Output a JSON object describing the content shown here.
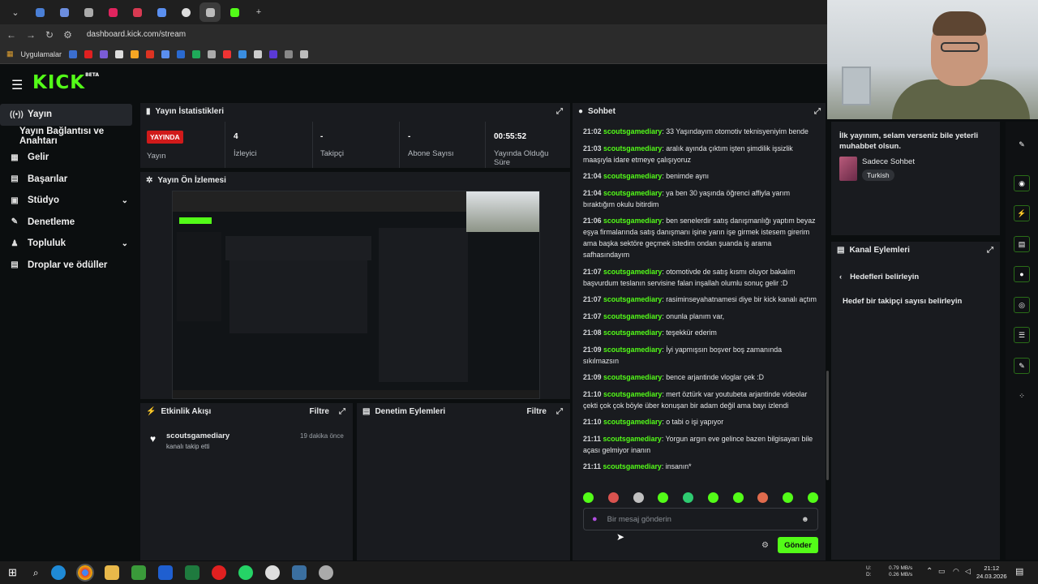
{
  "browser": {
    "url": "dashboard.kick.com/stream",
    "bookmarks_label": "Uygulamalar",
    "tab_colors": [
      "#4a7fd6",
      "#6c8ee0",
      "#aaaaaa",
      "#e0245e",
      "#d83a52",
      "#5a8ff0",
      "#dddddd",
      "#bbbbbb",
      "#53fc18"
    ]
  },
  "kick": {
    "logo": "KICK",
    "logo_sup": "BETA",
    "accent": "#53fc18"
  },
  "sidebar": {
    "items": [
      {
        "label": "Yayın",
        "icon": "broadcast-icon"
      },
      {
        "label": "Yayın Bağlantısı ve Anahtarı",
        "icon": ""
      },
      {
        "label": "Gelir",
        "icon": "revenue-icon"
      },
      {
        "label": "Başarılar",
        "icon": "achievements-icon"
      },
      {
        "label": "Stüdyo",
        "icon": "studio-icon"
      },
      {
        "label": "Denetleme",
        "icon": "moderation-icon"
      },
      {
        "label": "Topluluk",
        "icon": "community-icon"
      },
      {
        "label": "Droplar ve ödüller",
        "icon": "drops-icon"
      }
    ]
  },
  "stats": {
    "title": "Yayın İstatistikleri",
    "live_badge": "YAYINDA",
    "live_label": "Yayın",
    "viewers_value": "4",
    "viewers_label": "İzleyici",
    "followers_value": "-",
    "followers_label": "Takipçi",
    "subs_value": "-",
    "subs_label": "Abone Sayısı",
    "uptime_value": "00:55:52",
    "uptime_label": "Yayında Olduğu Süre"
  },
  "preview": {
    "title": "Yayın Ön İzlemesi"
  },
  "activity": {
    "title": "Etkinlik Akışı",
    "filter": "Filtre",
    "event_user": "scoutsgamediary",
    "event_text": "kanalı takip etti",
    "event_time": "19 dakika önce"
  },
  "moderation": {
    "title": "Denetim Eylemleri",
    "filter": "Filtre"
  },
  "chat": {
    "title": "Sohbet",
    "messages": [
      {
        "time": "21:02",
        "user": "scoutsgamediary",
        "text": "33 Yaşındayım otomotiv teknisyeniyim bende"
      },
      {
        "time": "21:03",
        "user": "scoutsgamediary",
        "text": "aralık ayında çıktım işten şimdilik işsizlik maaşıyla idare etmeye çalışıyoruz"
      },
      {
        "time": "21:04",
        "user": "scoutsgamediary",
        "text": "benimde aynı"
      },
      {
        "time": "21:04",
        "user": "scoutsgamediary",
        "text": "ya ben 30 yaşında öğrenci affiyla yarım bıraktığım okulu bitirdim"
      },
      {
        "time": "21:06",
        "user": "scoutsgamediary",
        "text": "ben senelerdir satış danışmanlığı yaptım beyaz eşya firmalarında satış danışmanı işine yarın işe girmek istesem girerim ama başka sektöre geçmek istedim ondan şuanda iş arama safhasındayım"
      },
      {
        "time": "21:07",
        "user": "scoutsgamediary",
        "text": "otomotivde de satış kısmı oluyor bakalım başvurdum teslanın servisine falan inşallah olumlu sonuç gelir :D"
      },
      {
        "time": "21:07",
        "user": "scoutsgamediary",
        "text": "rasiminseyahatnamesi diye bir kick kanalı açtım"
      },
      {
        "time": "21:07",
        "user": "scoutsgamediary",
        "text": "onunla planım var,"
      },
      {
        "time": "21:08",
        "user": "scoutsgamediary",
        "text": "teşekkür ederim"
      },
      {
        "time": "21:09",
        "user": "scoutsgamediary",
        "text": "İyi yapmışsın boşver boş zamanında sıkılmazsın"
      },
      {
        "time": "21:09",
        "user": "scoutsgamediary",
        "text": "bence arjantinde vloglar çek :D"
      },
      {
        "time": "21:10",
        "user": "scoutsgamediary",
        "text": "mert öztürk var youtubeta arjantinde videolar çekti çok çok böyle über konuşan bir adam değil ama bayı izlendi"
      },
      {
        "time": "21:10",
        "user": "scoutsgamediary",
        "text": "o tabi o işi yapıyor"
      },
      {
        "time": "21:11",
        "user": "scoutsgamediary",
        "text": "Yorgun argın eve gelince bazen bilgisayarı bile açası gelmiyor inanın"
      },
      {
        "time": "21:11",
        "user": "scoutsgamediary",
        "text": "insanın*"
      }
    ],
    "emote_colors": [
      "#53fc18",
      "#d9534f",
      "#c0c0c0",
      "#53fc18",
      "#2ecc71",
      "#53fc18",
      "#53fc18",
      "#e06b4d",
      "#53fc18",
      "#53fc18"
    ],
    "input_placeholder": "Bir mesaj gönderin",
    "send_label": "Gönder"
  },
  "stream_info": {
    "title_text": "İlk yayınım, selam verseniz bile yeterli muhabbet olsun.",
    "category": "Sadece Sohbet",
    "tag": "Turkish"
  },
  "channel_actions": {
    "title": "Kanal Eylemleri",
    "back_label": "Hedefleri belirleyin",
    "item": "Hedef bir takipçi sayısı belirleyin"
  },
  "taskbar": {
    "net_up": "0.79 MB/s",
    "net_down": "0.26 MB/s",
    "net_up_label": "U:",
    "net_down_label": "D:",
    "time": "21:12",
    "date": "24.03.2026"
  }
}
